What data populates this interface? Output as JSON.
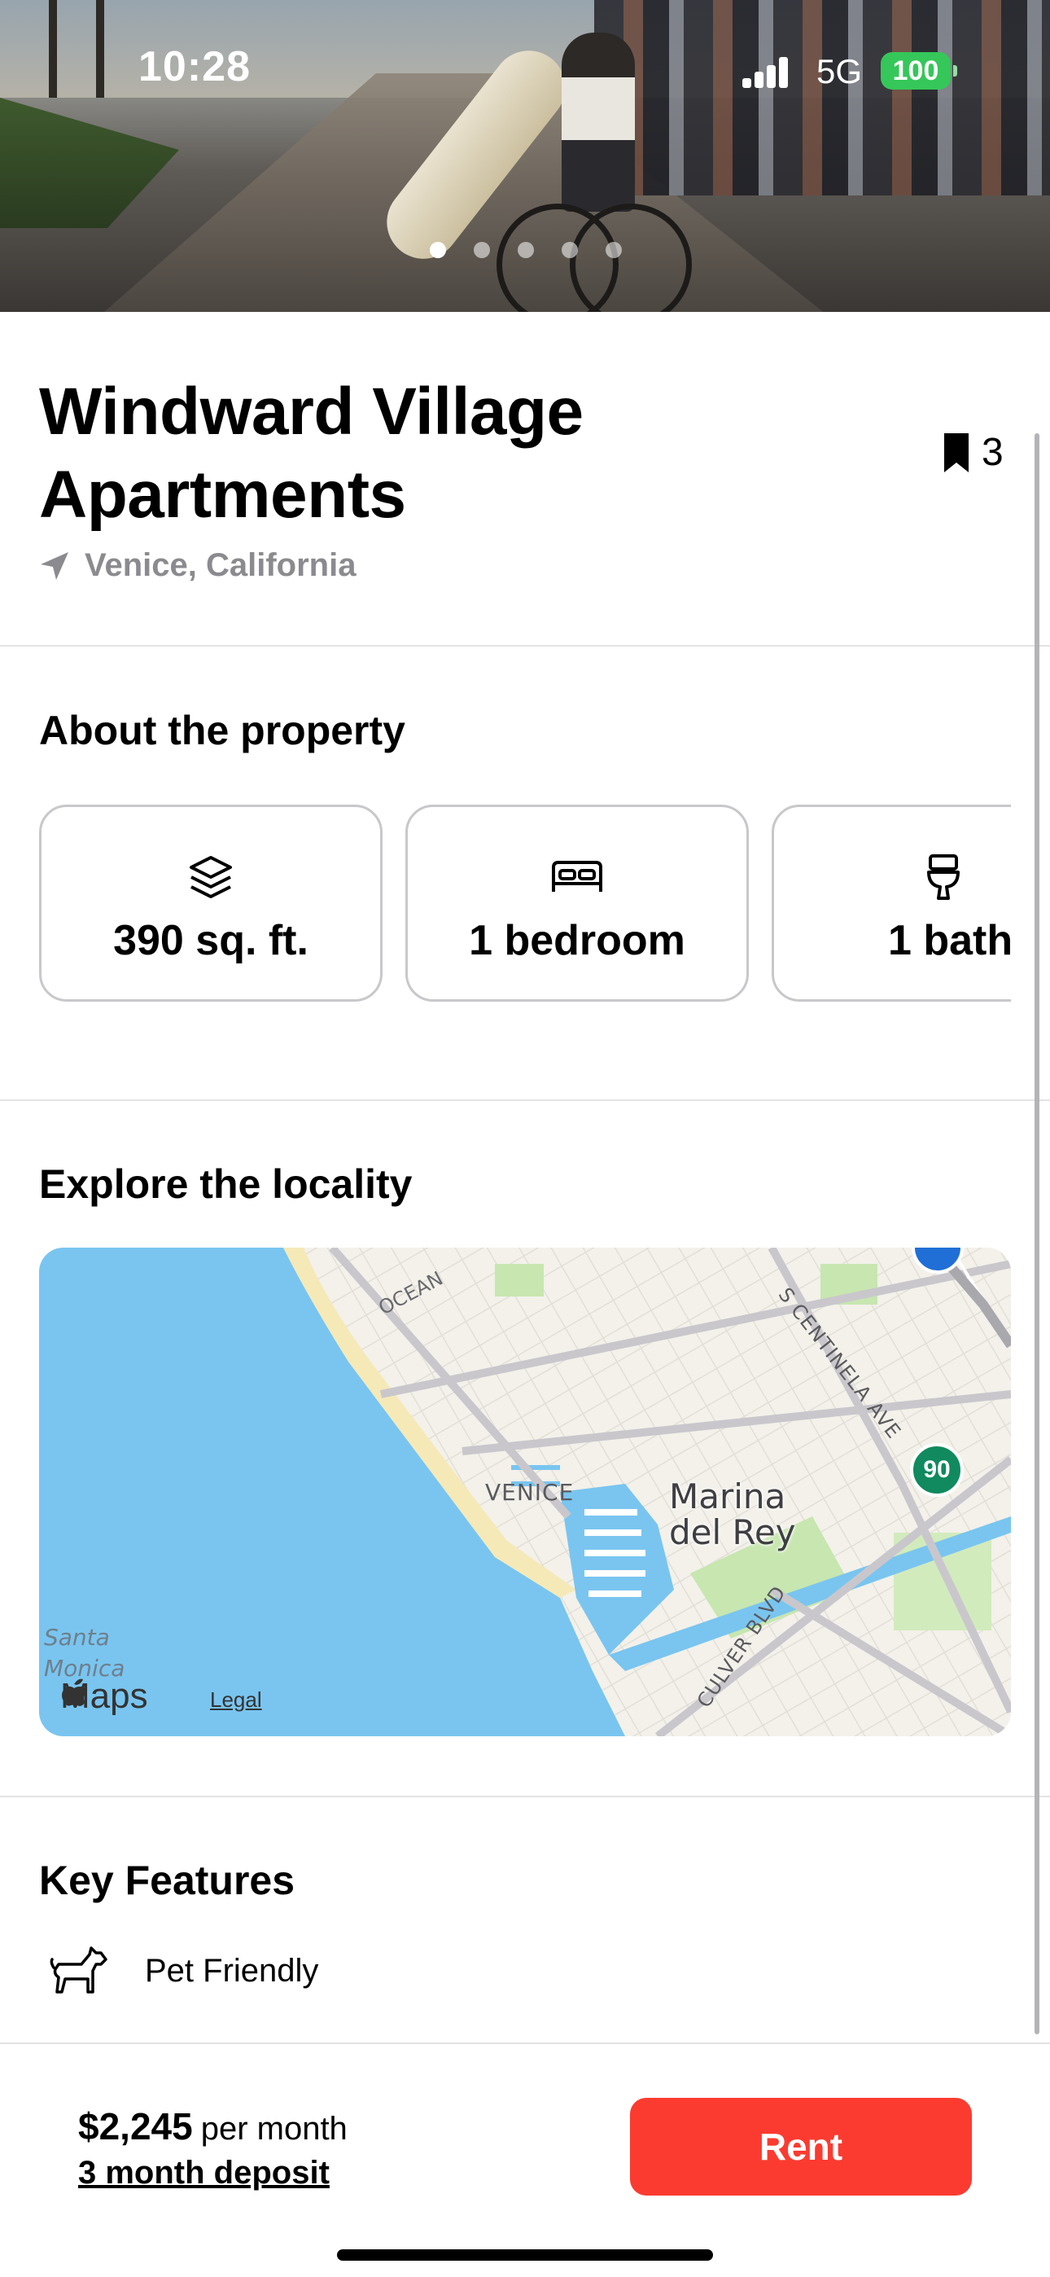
{
  "status_bar": {
    "time": "10:28",
    "network": "5G",
    "battery": "100"
  },
  "gallery": {
    "page_count": 5,
    "active_index": 0
  },
  "listing": {
    "title": "Windward Village Apartments",
    "bookmark_count": "3",
    "location": "Venice, California"
  },
  "about": {
    "heading": "About the property",
    "stats": [
      {
        "icon": "layers-icon",
        "value": "390 sq. ft."
      },
      {
        "icon": "bed-icon",
        "value": "1 bedroom"
      },
      {
        "icon": "toilet-icon",
        "value": "1 bath"
      }
    ]
  },
  "locality": {
    "heading": "Explore the locality",
    "map_labels": {
      "venice": "VENICE",
      "marina_line1": "Marina",
      "marina_line2": "del Rey",
      "santa_line1": "Santa",
      "santa_line2": "Monica",
      "ocean": "OCEAN",
      "centinela": "S CENTINELA AVE",
      "culver": "CULVER BLVD",
      "route": "90"
    },
    "maps_brand": "Maps",
    "legal": "Legal"
  },
  "features": {
    "heading": "Key Features",
    "items": [
      {
        "icon": "dog-icon",
        "label": "Pet Friendly"
      }
    ]
  },
  "footer": {
    "price": "$2,245",
    "price_unit": "per month",
    "deposit": "3 month deposit",
    "rent_label": "Rent",
    "accent_color": "#fb3b30"
  }
}
